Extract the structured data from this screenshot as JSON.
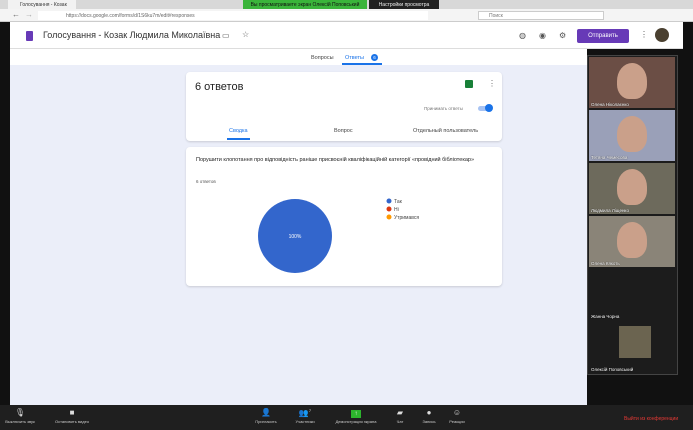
{
  "browser": {
    "tab_title": "Голосування - Козак",
    "share_banner": "Вы просматриваете экран Олексій Поповський",
    "view_options": "Настройки просмотра",
    "url": "https://docs.google.com/forms/d/1S6ku7m/edit#responses",
    "search_placeholder": "Поиск"
  },
  "form": {
    "title": "Голосування - Козак Людмила Миколаївна",
    "send_label": "Отправить",
    "tabs": [
      {
        "label": "Вопросы"
      },
      {
        "label": "Ответы",
        "badge": "6"
      }
    ]
  },
  "summary": {
    "count_title": "6 ответов",
    "accept_label": "Принимать ответы",
    "accepting": true,
    "subtabs": [
      "Сводка",
      "Вопрос",
      "Отдельный пользователь"
    ]
  },
  "question": {
    "text": "Порушити клопотання про відповідність раніше присвоєній кваліфікаційній категорії «провідний бібліотекар»",
    "responses": "6 ответов"
  },
  "chart_data": {
    "type": "pie",
    "title": "Порушити клопотання про відповідність раніше присвоєній кваліфікаційній категорії «провідний бібліотекар»",
    "categories": [
      "Так",
      "Ні",
      "Утримався"
    ],
    "values": [
      100,
      0,
      0
    ],
    "colors": [
      "#3366cc",
      "#dc3912",
      "#ff9900"
    ],
    "data_labels": [
      "100%"
    ],
    "legend": "right"
  },
  "participants": [
    {
      "name": "Олена Ніколаєнко",
      "color": "#6b4e45"
    },
    {
      "name": "Тетяна Чемесова",
      "color": "#9aa0b8"
    },
    {
      "name": "Людмила Ліщенко",
      "color": "#6d6a5c"
    },
    {
      "name": "Олена Кякоть",
      "color": "#8a8478"
    },
    {
      "name": "Жанна Чорна",
      "color": "#1c1c1c"
    },
    {
      "name": "Олексій Поповський",
      "color": "#1c1c1c"
    }
  ],
  "zoom_toolbar": {
    "mute": "Выключить звук",
    "video": "Остановить видео",
    "invite": "Пригласить",
    "participants": "Участники",
    "participants_count": "7",
    "share": "Демонстрация экрана",
    "chat": "Чат",
    "record": "Запись",
    "reactions": "Реакции",
    "leave": "Выйти из конференции"
  }
}
